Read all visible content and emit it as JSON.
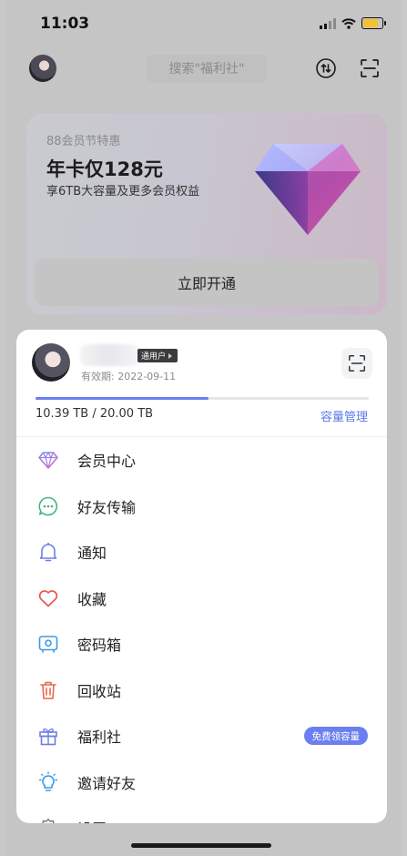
{
  "status_bar": {
    "time": "11:03"
  },
  "header": {
    "search_placeholder": "搜索\"福利社\""
  },
  "promo": {
    "subtitle": "88会员节特惠",
    "title": "年卡仅128元",
    "description": "享6TB大容量及更多会员权益",
    "button_label": "立即开通"
  },
  "profile": {
    "badge_label": "通用户",
    "validity": "有效期: 2022-09-11",
    "storage_used_tb": 10.39,
    "storage_total_tb": 20.0,
    "storage_fraction": 0.52,
    "storage_text": "10.39 TB / 20.00 TB",
    "manage_label": "容量管理"
  },
  "menu": {
    "items": [
      {
        "label": "会员中心",
        "icon": "diamond-icon"
      },
      {
        "label": "好友传输",
        "icon": "chat-bubble-icon"
      },
      {
        "label": "通知",
        "icon": "bell-icon"
      },
      {
        "label": "收藏",
        "icon": "heart-icon"
      },
      {
        "label": "密码箱",
        "icon": "safe-icon"
      },
      {
        "label": "回收站",
        "icon": "trash-icon"
      },
      {
        "label": "福利社",
        "icon": "gift-icon",
        "tag": "免费领容量"
      },
      {
        "label": "邀请好友",
        "icon": "lightbulb-icon"
      },
      {
        "label": "设置",
        "icon": "gear-icon"
      }
    ]
  },
  "colors": {
    "accent": "#6b7df0",
    "link": "#5a79e8",
    "trash": "#e8664d",
    "heart": "#e8574d",
    "chat": "#3fb37f"
  }
}
